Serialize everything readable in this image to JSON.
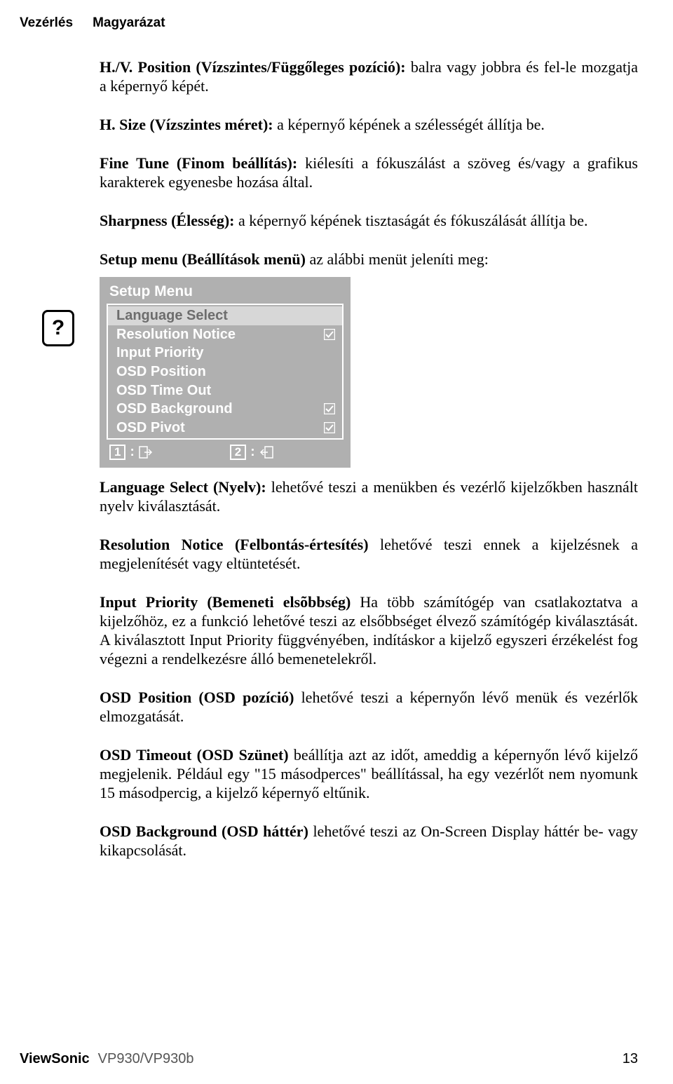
{
  "header": {
    "col1": "Vezérlés",
    "col2": "Magyarázat"
  },
  "icon": {
    "symbol": "?"
  },
  "paras": {
    "p1": {
      "bold": "H./V. Position (Vízszintes/Függőleges pozíció):",
      "rest": " balra vagy jobbra és fel-le mozgatja a képernyő képét."
    },
    "p2": {
      "bold": "H. Size (Vízszintes méret):",
      "rest": " a képernyő képének a szélességét állítja be."
    },
    "p3": {
      "bold": "Fine Tune (Finom beállítás):",
      "rest": " kiélesíti a fókuszálást a szöveg és/vagy a grafikus karakterek egyenesbe hozása által."
    },
    "p4": {
      "bold": "Sharpness (Élesség):",
      "rest": " a képernyő képének tisztaságát és fókuszálását állítja be."
    },
    "p5": {
      "bold": "Setup menu (Beállítások menü)",
      "rest": " az alábbi menüt jeleníti meg:"
    },
    "p6": {
      "bold": "Language Select (Nyelv):",
      "rest": " lehetővé teszi a menükben és vezérlő kijelzőkben használt nyelv kiválasztását."
    },
    "p7": {
      "bold": "Resolution Notice (Felbontás-értesítés)",
      "rest": " lehetővé teszi ennek a kijelzésnek a megjelenítését vagy eltüntetését."
    },
    "p8": {
      "bold": "Input Priority (Bemeneti elsõbbség)",
      "rest": " Ha több számítógép van csatlakoztatva a kijelzőhöz, ez a funkció lehetővé teszi az elsőbbséget élvező számítógép kiválasztását. A kiválasztott Input Priority függvényében, indításkor a kijelző egyszeri érzékelést fog végezni a rendelkezésre álló bemenetelekről."
    },
    "p9": {
      "bold": "OSD Position (OSD pozíció)",
      "rest": " lehetővé teszi a képernyőn lévő menük és vezérlők elmozgatását."
    },
    "p10": {
      "bold": "OSD Timeout (OSD Szünet)",
      "rest": " beállítja azt az időt, ameddig a képernyőn lévő kijelző megjelenik. Például egy \"15 másodperces\" beállítással, ha egy vezérlőt nem nyomunk 15 másodpercig, a kijelző képernyő eltűnik."
    },
    "p11": {
      "bold": "OSD Background (OSD háttér)",
      "rest": " lehetővé teszi az On-Screen Display háttér be- vagy kikapcsolását."
    }
  },
  "osd": {
    "title": "Setup Menu",
    "items": [
      {
        "label": "Language Select",
        "selected": true,
        "check": false
      },
      {
        "label": "Resolution Notice",
        "selected": false,
        "check": true
      },
      {
        "label": "Input Priority",
        "selected": false,
        "check": false
      },
      {
        "label": "OSD Position",
        "selected": false,
        "check": false
      },
      {
        "label": "OSD Time Out",
        "selected": false,
        "check": false
      },
      {
        "label": "OSD Background",
        "selected": false,
        "check": true
      },
      {
        "label": "OSD Pivot",
        "selected": false,
        "check": true
      }
    ],
    "footer": {
      "btn1": "1",
      "btn2": "2"
    }
  },
  "footer": {
    "brand": "ViewSonic",
    "model": "VP930/VP930b",
    "page": "13"
  }
}
